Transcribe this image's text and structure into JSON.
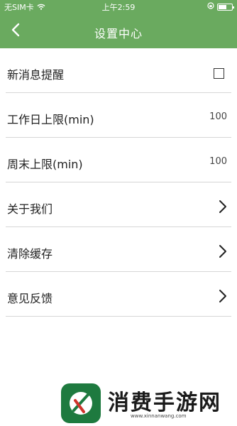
{
  "status": {
    "carrier": "无SIM卡",
    "time": "上午2:59",
    "battery_level": 0.6
  },
  "header": {
    "back_icon": "chevron-left-icon",
    "title": "设置中心",
    "bg_color": "#6aaa5f"
  },
  "settings": [
    {
      "label": "新消息提醒",
      "control": "checkbox",
      "checked": false
    },
    {
      "label": "工作日上限(min)",
      "control": "value",
      "value": "100"
    },
    {
      "label": "周末上限(min)",
      "control": "value",
      "value": "100"
    },
    {
      "label": "关于我们",
      "control": "chevron",
      "icon": "chevron-right-icon"
    },
    {
      "label": "清除缓存",
      "control": "chevron",
      "icon": "chevron-right-icon"
    },
    {
      "label": "意见反馈",
      "control": "chevron",
      "icon": "chevron-right-icon"
    }
  ],
  "watermark": {
    "text": "消费手游网",
    "url": "www.xinnanwang.com"
  }
}
